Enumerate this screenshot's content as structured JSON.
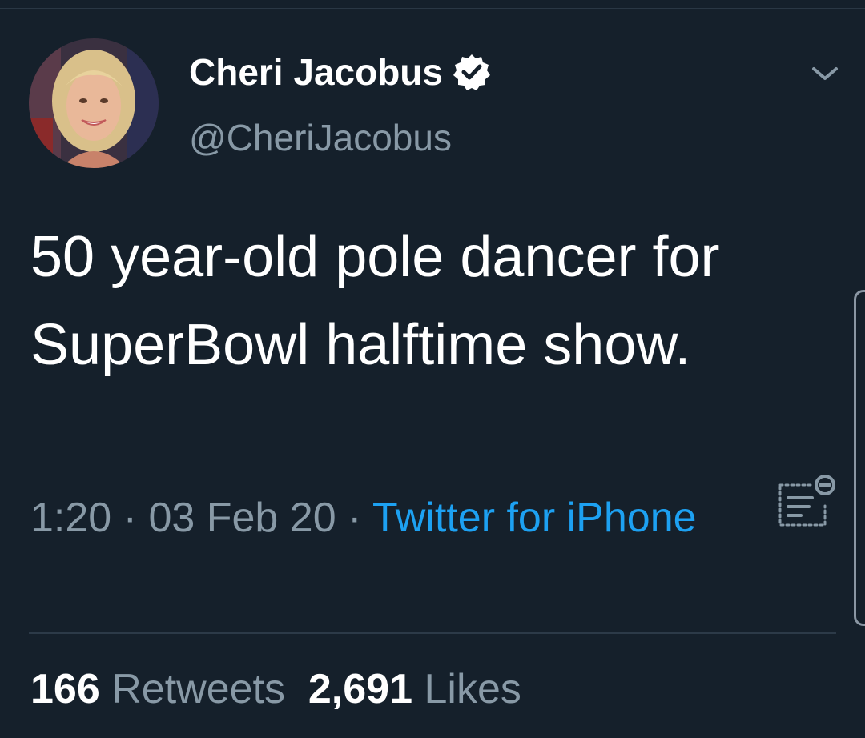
{
  "user": {
    "display_name": "Cheri Jacobus",
    "handle": "@CheriJacobus",
    "verified_icon": "verified-badge-icon",
    "avatar_icon": "profile-photo"
  },
  "tweet": {
    "text": "50 year-old pole dancer for SuperBowl halftime show.",
    "time": "1:20",
    "separator": " · ",
    "date": "03 Feb 20",
    "source": "Twitter for iPhone"
  },
  "stats": {
    "retweets_count": "166",
    "retweets_label": "Retweets",
    "likes_count": "2,691",
    "likes_label": "Likes"
  },
  "icons": {
    "menu": "chevron-down-icon",
    "translate": "translate-icon"
  },
  "colors": {
    "background": "#15202b",
    "link": "#1da1f2",
    "secondary_text": "#8899a6",
    "primary_text": "#ffffff"
  }
}
